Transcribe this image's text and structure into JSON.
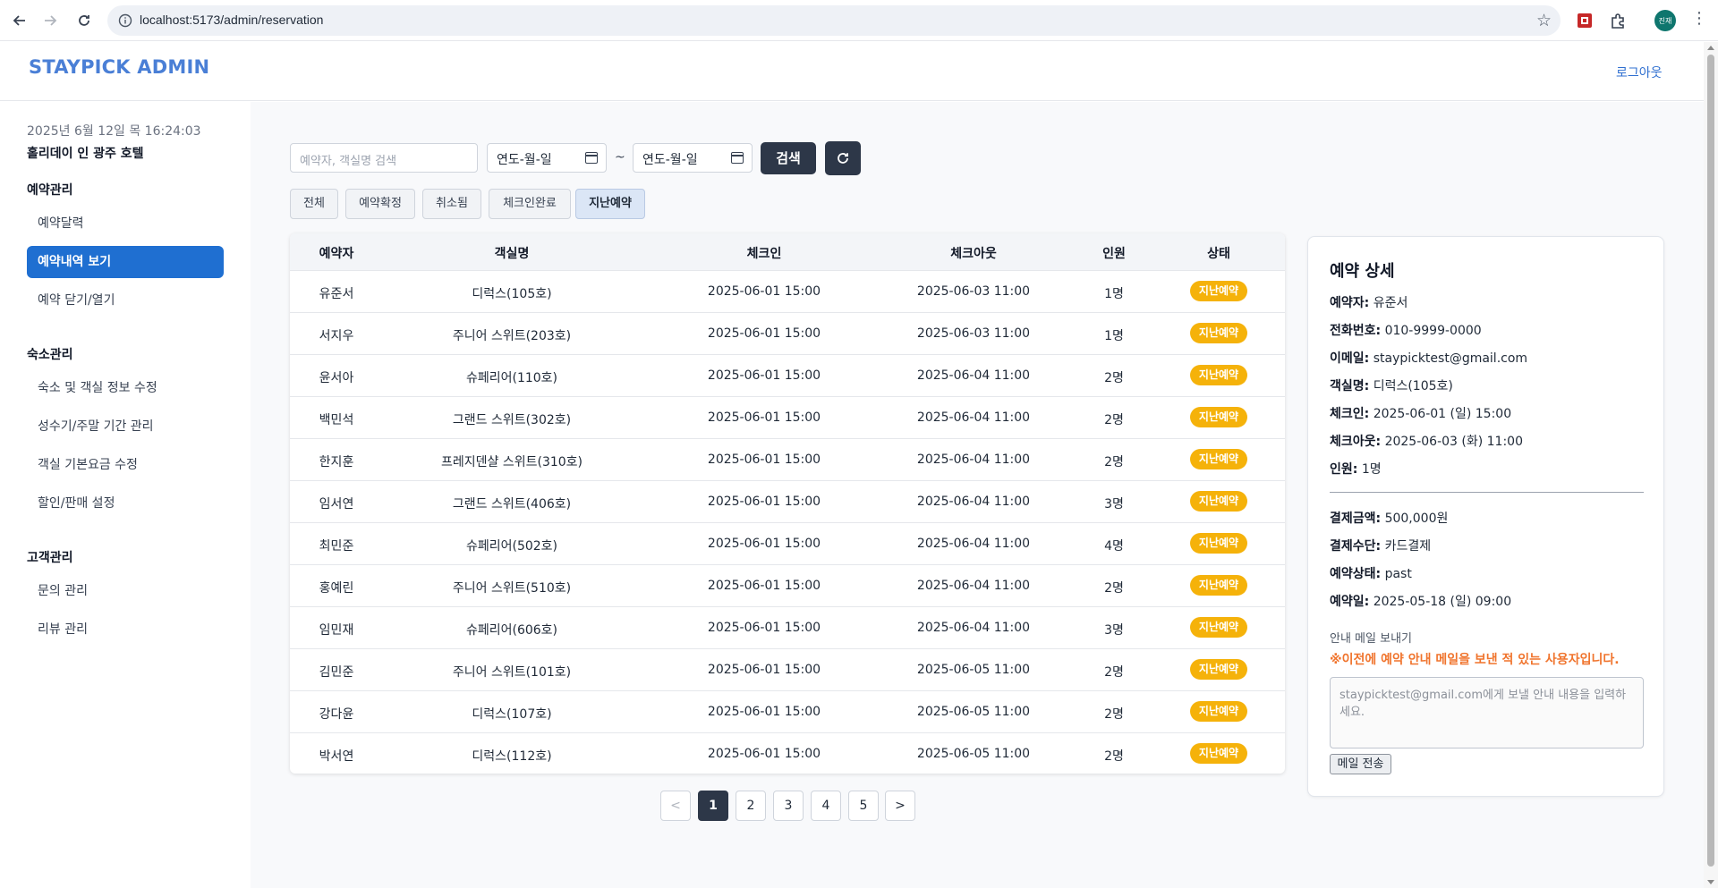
{
  "browser": {
    "url": "localhost:5173/admin/reservation",
    "profile_initials": "진재"
  },
  "header": {
    "brand": "STAYPICK ADMIN",
    "logout": "로그아웃"
  },
  "sidebar": {
    "clock": "2025년 6월 12일 목 16:24:03",
    "hotel": "홀리데이 인 광주 호텔",
    "sections": [
      {
        "title": "예약관리",
        "items": [
          "예약달력",
          "예약내역 보기",
          "예약 닫기/열기"
        ]
      },
      {
        "title": "숙소관리",
        "items": [
          "숙소 및 객실 정보 수정",
          "성수기/주말 기간 관리",
          "객실 기본요금 수정",
          "할인/판매 설정"
        ]
      },
      {
        "title": "고객관리",
        "items": [
          "문의 관리",
          "리뷰 관리"
        ]
      }
    ],
    "active_item": "예약내역 보기"
  },
  "search": {
    "placeholder": "예약자, 객실명 검색",
    "date_from": "연도-월-일",
    "tilde": "~",
    "date_to": "연도-월-일",
    "button": "검색"
  },
  "filters": [
    "전체",
    "예약확정",
    "취소됨",
    "체크인완료",
    "지난예약"
  ],
  "active_filter": "지난예약",
  "table": {
    "headers": [
      "예약자",
      "객실명",
      "체크인",
      "체크아웃",
      "인원",
      "상태"
    ],
    "rows": [
      [
        "유준서",
        "디럭스(105호)",
        "2025-06-01 15:00",
        "2025-06-03 11:00",
        "1명",
        "지난예약"
      ],
      [
        "서지우",
        "주니어 스위트(203호)",
        "2025-06-01 15:00",
        "2025-06-03 11:00",
        "1명",
        "지난예약"
      ],
      [
        "윤서아",
        "슈페리어(110호)",
        "2025-06-01 15:00",
        "2025-06-04 11:00",
        "2명",
        "지난예약"
      ],
      [
        "백민석",
        "그랜드 스위트(302호)",
        "2025-06-01 15:00",
        "2025-06-04 11:00",
        "2명",
        "지난예약"
      ],
      [
        "한지훈",
        "프레지덴샬 스위트(310호)",
        "2025-06-01 15:00",
        "2025-06-04 11:00",
        "2명",
        "지난예약"
      ],
      [
        "임서연",
        "그랜드 스위트(406호)",
        "2025-06-01 15:00",
        "2025-06-04 11:00",
        "3명",
        "지난예약"
      ],
      [
        "최민준",
        "슈페리어(502호)",
        "2025-06-01 15:00",
        "2025-06-04 11:00",
        "4명",
        "지난예약"
      ],
      [
        "홍예린",
        "주니어 스위트(510호)",
        "2025-06-01 15:00",
        "2025-06-04 11:00",
        "2명",
        "지난예약"
      ],
      [
        "임민재",
        "슈페리어(606호)",
        "2025-06-01 15:00",
        "2025-06-04 11:00",
        "3명",
        "지난예약"
      ],
      [
        "김민준",
        "주니어 스위트(101호)",
        "2025-06-01 15:00",
        "2025-06-05 11:00",
        "2명",
        "지난예약"
      ],
      [
        "강다윤",
        "디럭스(107호)",
        "2025-06-01 15:00",
        "2025-06-05 11:00",
        "2명",
        "지난예약"
      ],
      [
        "박서연",
        "디럭스(112호)",
        "2025-06-01 15:00",
        "2025-06-05 11:00",
        "2명",
        "지난예약"
      ]
    ]
  },
  "pagination": {
    "prev": "<",
    "pages": [
      "1",
      "2",
      "3",
      "4",
      "5"
    ],
    "current": "1",
    "next": ">"
  },
  "detail": {
    "title": "예약 상세",
    "fields": [
      {
        "label": "예약자:",
        "value": "유준서"
      },
      {
        "label": "전화번호:",
        "value": "010-9999-0000"
      },
      {
        "label": "이메일:",
        "value": "staypicktest@gmail.com"
      },
      {
        "label": "객실명:",
        "value": "디럭스(105호)"
      },
      {
        "label": "체크인:",
        "value": "2025-06-01 (일) 15:00"
      },
      {
        "label": "체크아웃:",
        "value": "2025-06-03 (화) 11:00"
      },
      {
        "label": "인원:",
        "value": "1명"
      }
    ],
    "payment_fields": [
      {
        "label": "결제금액:",
        "value": "500,000원"
      },
      {
        "label": "결제수단:",
        "value": "카드결제"
      },
      {
        "label": "예약상태:",
        "value": "past"
      },
      {
        "label": "예약일:",
        "value": "2025-05-18 (일) 09:00"
      }
    ],
    "mail_label": "안내 메일 보내기",
    "mail_warning": "※이전에 예약 안내 메일을 보낸 적 있는 사용자입니다.",
    "mail_placeholder": "staypicktest@gmail.com에게 보낼 안내 내용을 입력하세요.",
    "mail_button": "메일 전송"
  },
  "colors": {
    "brand": "#4a7fd6",
    "active_nav": "#1f6fd1",
    "dark_button": "#2d3748",
    "status_badge": "#f5b20a",
    "warning": "#f0742d"
  }
}
